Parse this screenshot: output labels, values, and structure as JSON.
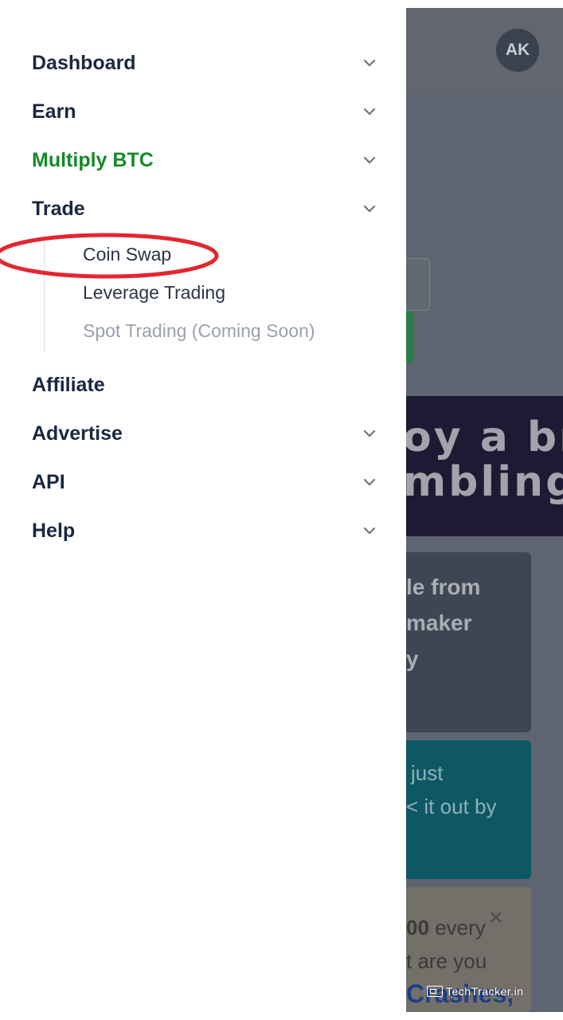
{
  "background": {
    "avatar_initials": "AK",
    "banner_line1": "oy a br",
    "banner_line2": "mbling",
    "card1_lines": [
      "le from",
      "maker",
      "y"
    ],
    "card2_lines": [
      "just",
      "< it out by"
    ],
    "card3_line1_bold": "00",
    "card3_line1_rest": " every",
    "card3_line2": "t are you",
    "card3_line3": "Crashes,",
    "card3_close": "×"
  },
  "menu": {
    "items": [
      {
        "label": "Dashboard"
      },
      {
        "label": "Earn"
      },
      {
        "label": "Multiply BTC"
      },
      {
        "label": "Trade"
      },
      {
        "label": "Affiliate"
      },
      {
        "label": "Advertise"
      },
      {
        "label": "API"
      },
      {
        "label": "Help"
      }
    ],
    "active_color": "#158a2a",
    "trade_sub": [
      {
        "label": "Coin Swap"
      },
      {
        "label": "Leverage Trading"
      },
      {
        "label": "Spot Trading (Coming Soon)"
      }
    ]
  },
  "watermark": "TechTracker.in",
  "highlight_color": "#e32630"
}
